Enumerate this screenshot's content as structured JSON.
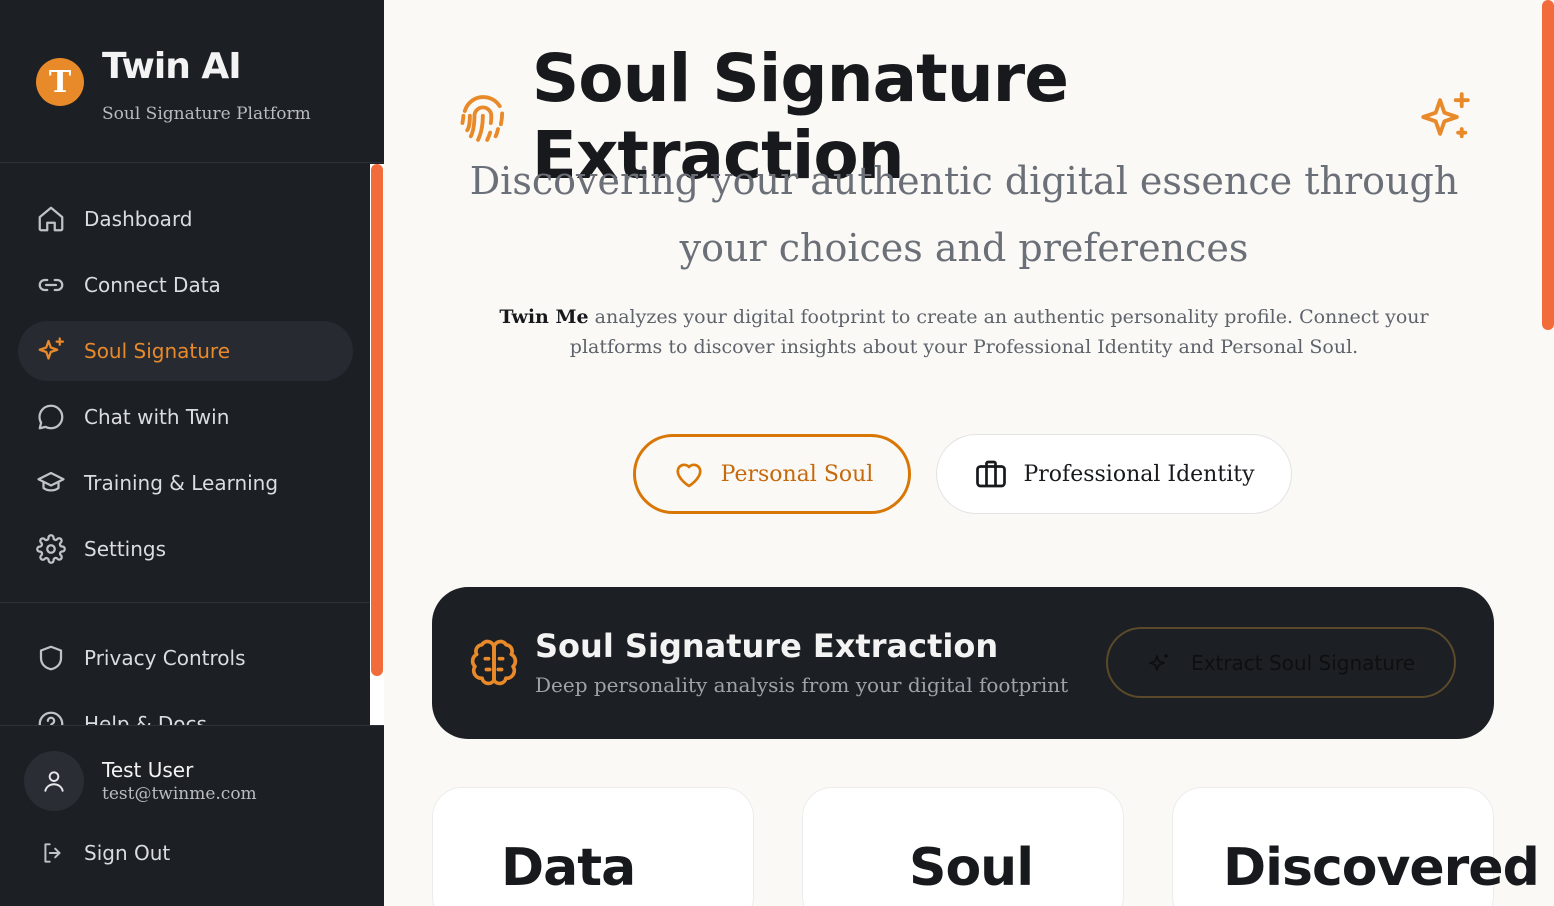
{
  "brand": {
    "logo_letter": "T",
    "title": "Twin AI",
    "subtitle": "Soul Signature Platform"
  },
  "sidebar": {
    "items": [
      {
        "label": "Dashboard",
        "icon": "home-icon",
        "active": false
      },
      {
        "label": "Connect Data",
        "icon": "link-icon",
        "active": false
      },
      {
        "label": "Soul Signature",
        "icon": "sparkles-icon",
        "active": true
      },
      {
        "label": "Chat with Twin",
        "icon": "chat-icon",
        "active": false
      },
      {
        "label": "Training & Learning",
        "icon": "graduation-cap-icon",
        "active": false
      },
      {
        "label": "Settings",
        "icon": "gear-icon",
        "active": false
      }
    ],
    "secondary_items": [
      {
        "label": "Privacy Controls",
        "icon": "shield-icon"
      },
      {
        "label": "Help & Docs",
        "icon": "help-circle-icon"
      }
    ],
    "user": {
      "name": "Test User",
      "email": "test@twinme.com"
    },
    "sign_out_label": "Sign Out"
  },
  "main": {
    "title": "Soul Signature Extraction",
    "subtitle": "Discovering your authentic digital essence through your choices and preferences",
    "description_brand": "Twin Me",
    "description": " analyzes your digital footprint to create an authentic personality profile. Connect your platforms to discover insights about your Professional Identity and Personal Soul.",
    "toggles": {
      "personal": "Personal Soul",
      "professional": "Professional Identity",
      "selected": "personal"
    },
    "extract_card": {
      "title": "Soul Signature Extraction",
      "subtitle": "Deep personality analysis from your digital footprint",
      "button": "Extract Soul Signature"
    },
    "stat_cards": [
      "Data",
      "Soul",
      "Discovered"
    ]
  },
  "colors": {
    "accent": "#E8892A",
    "sidebar_bg": "#1C1F23",
    "page_bg": "#FAF9F6",
    "scrollbar": "#F26B3A"
  }
}
